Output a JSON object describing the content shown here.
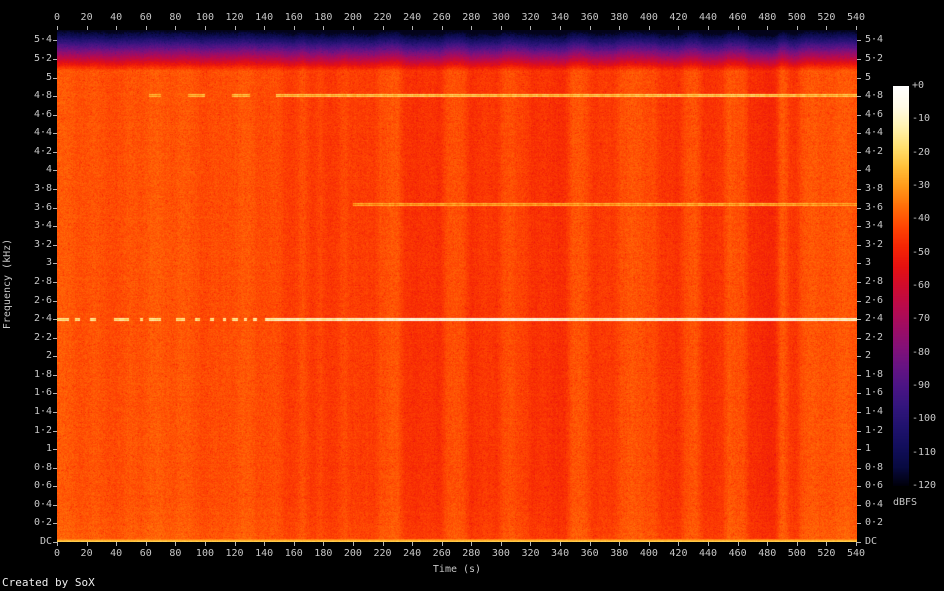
{
  "credit": "Created by SoX",
  "colors": {
    "background": "#000000",
    "text": "#c8c8c8",
    "tick": "#b4b4b4",
    "credit_text": "#f0f0f0"
  },
  "chart_data": {
    "type": "heatmap",
    "subtype": "audio-spectrogram",
    "title": "",
    "xlabel": "Time (s)",
    "ylabel": "Frequency (kHz)",
    "colorbar_label": "dBFS",
    "x_range_s": [
      0,
      540
    ],
    "freq_range_khz": [
      0,
      5.5125
    ],
    "x_ticks": [
      0,
      20,
      40,
      60,
      80,
      100,
      120,
      140,
      160,
      180,
      200,
      220,
      240,
      260,
      280,
      300,
      320,
      340,
      360,
      380,
      400,
      420,
      440,
      460,
      480,
      500,
      520,
      540
    ],
    "y_ticks": [
      {
        "v": 5.4,
        "label": "5·4"
      },
      {
        "v": 5.2,
        "label": "5·2"
      },
      {
        "v": 5.0,
        "label": "5"
      },
      {
        "v": 4.8,
        "label": "4·8"
      },
      {
        "v": 4.6,
        "label": "4·6"
      },
      {
        "v": 4.4,
        "label": "4·4"
      },
      {
        "v": 4.2,
        "label": "4·2"
      },
      {
        "v": 4.0,
        "label": "4"
      },
      {
        "v": 3.8,
        "label": "3·8"
      },
      {
        "v": 3.6,
        "label": "3·6"
      },
      {
        "v": 3.4,
        "label": "3·4"
      },
      {
        "v": 3.2,
        "label": "3·2"
      },
      {
        "v": 3.0,
        "label": "3"
      },
      {
        "v": 2.8,
        "label": "2·8"
      },
      {
        "v": 2.6,
        "label": "2·6"
      },
      {
        "v": 2.4,
        "label": "2·4"
      },
      {
        "v": 2.2,
        "label": "2·2"
      },
      {
        "v": 2.0,
        "label": "2"
      },
      {
        "v": 1.8,
        "label": "1·8"
      },
      {
        "v": 1.6,
        "label": "1·6"
      },
      {
        "v": 1.4,
        "label": "1·4"
      },
      {
        "v": 1.2,
        "label": "1·2"
      },
      {
        "v": 1.0,
        "label": "1"
      },
      {
        "v": 0.8,
        "label": "0·8"
      },
      {
        "v": 0.6,
        "label": "0·6"
      },
      {
        "v": 0.4,
        "label": "0·4"
      },
      {
        "v": 0.2,
        "label": "0·2"
      },
      {
        "v": 0.0,
        "label": "DC"
      }
    ],
    "colorbar_ticks": [
      {
        "db": 0,
        "label": "+0"
      },
      {
        "db": -10,
        "label": "-10"
      },
      {
        "db": -20,
        "label": "-20"
      },
      {
        "db": -30,
        "label": "-30"
      },
      {
        "db": -40,
        "label": "-40"
      },
      {
        "db": -50,
        "label": "-50"
      },
      {
        "db": -60,
        "label": "-60"
      },
      {
        "db": -70,
        "label": "-70"
      },
      {
        "db": -80,
        "label": "-80"
      },
      {
        "db": -90,
        "label": "-90"
      },
      {
        "db": -100,
        "label": "-100"
      },
      {
        "db": -110,
        "label": "-110"
      },
      {
        "db": -120,
        "label": "-120"
      }
    ],
    "colorbar_range_db": [
      0,
      -120
    ],
    "palette_stops": [
      [
        0,
        "#ffffff"
      ],
      [
        -6,
        "#fffbe8"
      ],
      [
        -12,
        "#fff3b2"
      ],
      [
        -18,
        "#ffe171"
      ],
      [
        -24,
        "#ffc13a"
      ],
      [
        -30,
        "#ff9a1a"
      ],
      [
        -36,
        "#ff6f08"
      ],
      [
        -42,
        "#ff4603"
      ],
      [
        -48,
        "#f62604"
      ],
      [
        -54,
        "#e61110"
      ],
      [
        -60,
        "#d00b2e"
      ],
      [
        -66,
        "#ba0a4c"
      ],
      [
        -72,
        "#a00c63"
      ],
      [
        -78,
        "#851077"
      ],
      [
        -84,
        "#671383"
      ],
      [
        -90,
        "#4b1485"
      ],
      [
        -96,
        "#33157d"
      ],
      [
        -102,
        "#20126e"
      ],
      [
        -108,
        "#120e5c"
      ],
      [
        -114,
        "#080a42"
      ],
      [
        -120,
        "#000008"
      ]
    ],
    "background_level_db": -40,
    "noise_sigma_db": 5.5,
    "top_rolloff": {
      "start_khz": 5.08,
      "slope_db_per_khz": 185,
      "floor_db": -118
    },
    "low_freq_boost": {
      "below_khz": 0.5,
      "max_db": 1.5
    },
    "dc_line_levels_db": [
      -34,
      -26,
      -22
    ],
    "time_bands": [
      [
        0,
        38,
        0
      ],
      [
        38,
        46,
        -1.2
      ],
      [
        46,
        96,
        0
      ],
      [
        96,
        112,
        -1.2
      ],
      [
        112,
        133,
        0
      ],
      [
        133,
        140,
        -1
      ],
      [
        140,
        152,
        -2
      ],
      [
        152,
        163,
        -3.5
      ],
      [
        163,
        168,
        -1.2
      ],
      [
        168,
        175,
        -4
      ],
      [
        175,
        181,
        -1.5
      ],
      [
        181,
        191,
        -4.5
      ],
      [
        191,
        197,
        -1
      ],
      [
        197,
        203,
        -3
      ],
      [
        203,
        216,
        -4.5
      ],
      [
        216,
        232,
        -1
      ],
      [
        232,
        240,
        -5
      ],
      [
        240,
        250,
        -6
      ],
      [
        250,
        261,
        -5
      ],
      [
        261,
        277,
        -0.8
      ],
      [
        277,
        299,
        -5.5
      ],
      [
        299,
        308,
        -1.5
      ],
      [
        308,
        319,
        -3
      ],
      [
        319,
        346,
        -5.5
      ],
      [
        346,
        360,
        -0.5
      ],
      [
        360,
        378,
        -5
      ],
      [
        378,
        406,
        -0.6
      ],
      [
        406,
        422,
        -5
      ],
      [
        422,
        434,
        -1
      ],
      [
        434,
        452,
        -5.5
      ],
      [
        452,
        466,
        -0.4
      ],
      [
        466,
        487,
        -7
      ],
      [
        487,
        493,
        0.5
      ],
      [
        493,
        501,
        -4.5
      ],
      [
        501,
        512,
        0
      ],
      [
        512,
        518,
        -1
      ],
      [
        518,
        540,
        -0.3
      ]
    ],
    "tones": [
      {
        "freq_khz": 2.4,
        "segments": [
          [
            0,
            8
          ],
          [
            12,
            15
          ],
          [
            22,
            26
          ],
          [
            38,
            48
          ],
          [
            56,
            58
          ],
          [
            62,
            70
          ],
          [
            80,
            86
          ],
          [
            93,
            96
          ],
          [
            103,
            106
          ],
          [
            112,
            114
          ],
          [
            118,
            122
          ],
          [
            126,
            128
          ],
          [
            132,
            135
          ],
          [
            140,
            540
          ]
        ],
        "level_keyframes": [
          [
            0,
            -24
          ],
          [
            40,
            -22
          ],
          [
            80,
            -23
          ],
          [
            120,
            -22
          ],
          [
            140,
            -20
          ],
          [
            155,
            -16
          ],
          [
            165,
            -19
          ],
          [
            180,
            -18
          ],
          [
            200,
            -17
          ],
          [
            215,
            -15
          ],
          [
            230,
            -13
          ],
          [
            250,
            -12
          ],
          [
            270,
            -13
          ],
          [
            285,
            -10
          ],
          [
            300,
            -9
          ],
          [
            315,
            -11
          ],
          [
            330,
            -12
          ],
          [
            345,
            -15
          ],
          [
            360,
            -17
          ],
          [
            375,
            -14
          ],
          [
            390,
            -13
          ],
          [
            405,
            -14
          ],
          [
            420,
            -15
          ],
          [
            435,
            -12
          ],
          [
            450,
            -9
          ],
          [
            465,
            -7
          ],
          [
            480,
            -8
          ],
          [
            490,
            -10
          ],
          [
            500,
            -14
          ],
          [
            515,
            -16
          ],
          [
            530,
            -16
          ],
          [
            540,
            -17
          ]
        ]
      },
      {
        "freq_khz": 4.81,
        "segments": [
          [
            62,
            70
          ],
          [
            88,
            100
          ],
          [
            118,
            130
          ],
          [
            148,
            540
          ]
        ],
        "level_keyframes": [
          [
            62,
            -33
          ],
          [
            148,
            -31
          ],
          [
            200,
            -30
          ],
          [
            250,
            -29
          ],
          [
            300,
            -29.5
          ],
          [
            350,
            -30
          ],
          [
            400,
            -29
          ],
          [
            450,
            -28
          ],
          [
            470,
            -27.5
          ],
          [
            500,
            -30
          ],
          [
            540,
            -31
          ]
        ]
      },
      {
        "freq_khz": 3.64,
        "segments": [
          [
            200,
            540
          ]
        ],
        "level_keyframes": [
          [
            200,
            -36
          ],
          [
            300,
            -35
          ],
          [
            400,
            -35
          ],
          [
            470,
            -34
          ],
          [
            540,
            -36
          ]
        ]
      }
    ]
  }
}
